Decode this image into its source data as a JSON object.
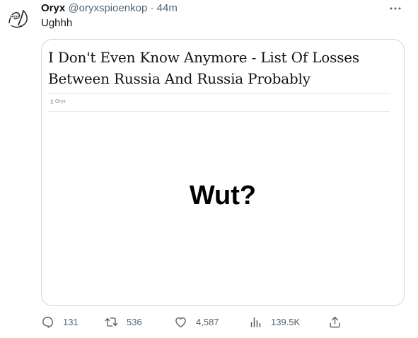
{
  "tweet": {
    "display_name": "Oryx",
    "handle": "@oryxspioenkop",
    "separator": "·",
    "time": "44m",
    "text": "Ughhh",
    "avatar_logo_text": "ORYX"
  },
  "card": {
    "title": "I Don't Even Know Anymore - List Of Losses Between Russia And Russia Probably",
    "byline": "Oryx",
    "image_text": "Wut?"
  },
  "actions": {
    "replies": "131",
    "retweets": "536",
    "likes": "4,587",
    "views": "139.5K"
  },
  "colors": {
    "text_primary": "#0f1419",
    "text_secondary": "#536471",
    "border": "#cfd9de"
  }
}
